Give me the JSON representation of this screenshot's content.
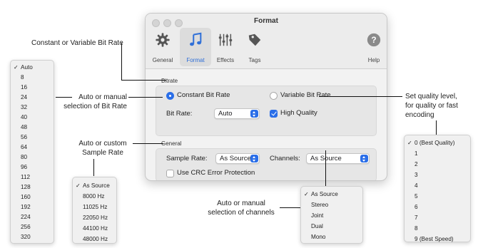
{
  "window": {
    "title": "Format",
    "toolbar": [
      {
        "label": "General",
        "icon": "gear-icon"
      },
      {
        "label": "Format",
        "icon": "music-note-icon",
        "active": true
      },
      {
        "label": "Effects",
        "icon": "equalizer-sliders-icon"
      },
      {
        "label": "Tags",
        "icon": "tag-icon"
      },
      {
        "label": "Help",
        "icon": "help-icon"
      }
    ],
    "bitrate": {
      "section_label": "Bitrate",
      "constant_label": "Constant Bit Rate",
      "variable_label": "Variable Bit Rate",
      "selected_mode": "constant",
      "bitrate_label": "Bit Rate:",
      "bitrate_value": "Auto",
      "high_quality_label": "High Quality",
      "high_quality_checked": true
    },
    "general": {
      "section_label": "General",
      "sample_rate_label": "Sample Rate:",
      "sample_rate_value": "As Source",
      "channels_label": "Channels:",
      "channels_value": "As Source",
      "crc_label": "Use CRC Error Protection",
      "crc_checked": false
    }
  },
  "menus": {
    "bitrate": {
      "selected": "Auto",
      "items": [
        "Auto",
        "8",
        "16",
        "24",
        "32",
        "40",
        "48",
        "56",
        "64",
        "80",
        "96",
        "112",
        "128",
        "160",
        "192",
        "224",
        "256",
        "320"
      ]
    },
    "sample_rate": {
      "selected": "As Source",
      "items": [
        "As Source",
        "8000 Hz",
        "11025 Hz",
        "22050 Hz",
        "44100 Hz",
        "48000 Hz"
      ]
    },
    "channels": {
      "selected": "As Source",
      "items": [
        "As Source",
        "Stereo",
        "Joint",
        "Dual",
        "Mono"
      ]
    },
    "quality": {
      "selected": "0 (Best Quality)",
      "items": [
        "0 (Best Quality)",
        "1",
        "2",
        "3",
        "4",
        "5",
        "6",
        "7",
        "8",
        "9 (Best Speed)"
      ]
    }
  },
  "callouts": {
    "bitrate_mode": "Constant or Variable Bit Rate",
    "bitrate_line1": "Auto or manual",
    "bitrate_line2": "selection of Bit Rate",
    "sample_line1": "Auto or custom",
    "sample_line2": "Sample Rate",
    "channels_line1": "Auto or manual",
    "channels_line2": "selection of channels",
    "quality_line1": "Set quality level,",
    "quality_line2": "for quality or fast",
    "quality_line3": "encoding"
  },
  "colors": {
    "accent": "#2a6ee8",
    "window_bg": "#f2f2f2",
    "group_bg": "#e6e6e6",
    "menu_bg": "#f0f0f0"
  }
}
